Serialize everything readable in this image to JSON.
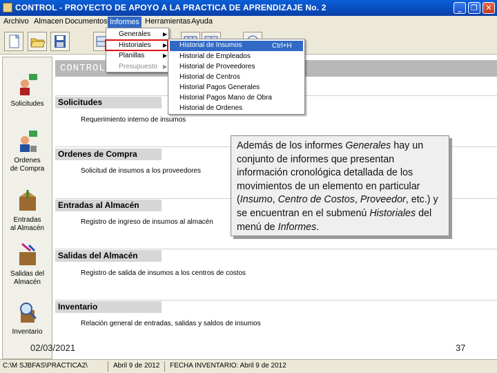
{
  "window": {
    "title": "CONTROL - PROYECTO DE APOYO A LA PRACTICA DE APRENDIZAJE No. 2"
  },
  "menubar": {
    "items": [
      "Archivo",
      "Almacen",
      "Documentos",
      "Informes",
      "Herramientas",
      "Ayuda"
    ],
    "active": "Informes"
  },
  "informes_menu": {
    "items": [
      {
        "label": "Generales",
        "disabled": false
      },
      {
        "label": "Historiales",
        "disabled": false
      },
      {
        "label": "Planillas",
        "disabled": false
      },
      {
        "label": "Presupuesto",
        "disabled": true
      }
    ]
  },
  "historiales_menu": {
    "items": [
      {
        "label": "Historial de Insumos",
        "shortcut": "Ctrl+H"
      },
      {
        "label": "Historial de Empleados"
      },
      {
        "label": "Historial de Proveedores"
      },
      {
        "label": "Historial de Centros"
      },
      {
        "label": "Historial Pagos Generales"
      },
      {
        "label": "Historial Pagos Mano de Obra"
      },
      {
        "label": "Historial de Ordenes"
      }
    ]
  },
  "main": {
    "header": "CONTROL -"
  },
  "sidebar": {
    "items": [
      {
        "label": "Solicitudes"
      },
      {
        "label": "Ordenes\nde Compra"
      },
      {
        "label": "Entradas\nal Almacén"
      },
      {
        "label": "Salidas del\nAlmacén"
      },
      {
        "label": "Inventario"
      }
    ]
  },
  "sections": [
    {
      "title": "Solicitudes",
      "description": "Requerimiento interno de insumos"
    },
    {
      "title": "Ordenes de Compra",
      "description": "Solicitud de insumos a los proveedores"
    },
    {
      "title": "Entradas al Almacén",
      "description": "Registro de ingreso de insumos al almacén"
    },
    {
      "title": "Salidas del Almacén",
      "description": "Registro de salida de insumos a los centros de costos"
    },
    {
      "title": "Inventario",
      "description": "Relación general de entradas, salidas y saldos de insumos"
    }
  ],
  "callout": {
    "text": "Además de los informes Generales hay un conjunto de informes que presentan información cronológica detallada de los movimientos de un elemento en particular (Insumo, Centro de Costos, Proveedor, etc.) y se encuentran en el submenú Historiales del menú de Informes."
  },
  "slide": {
    "date": "02/03/2021",
    "page_number": "37"
  },
  "statusbar": {
    "path": "C:\\M SJBFAS\\PRACTICA2\\",
    "date": "Abril 9 de 2012",
    "inventory": "FECHA INVENTARIO: Abril 9 de 2012"
  },
  "colors": {
    "titlebar": "#0a4fc8",
    "menu_highlight": "#316ac5",
    "red_highlight": "#e01010",
    "callout_bg": "#efefef"
  }
}
